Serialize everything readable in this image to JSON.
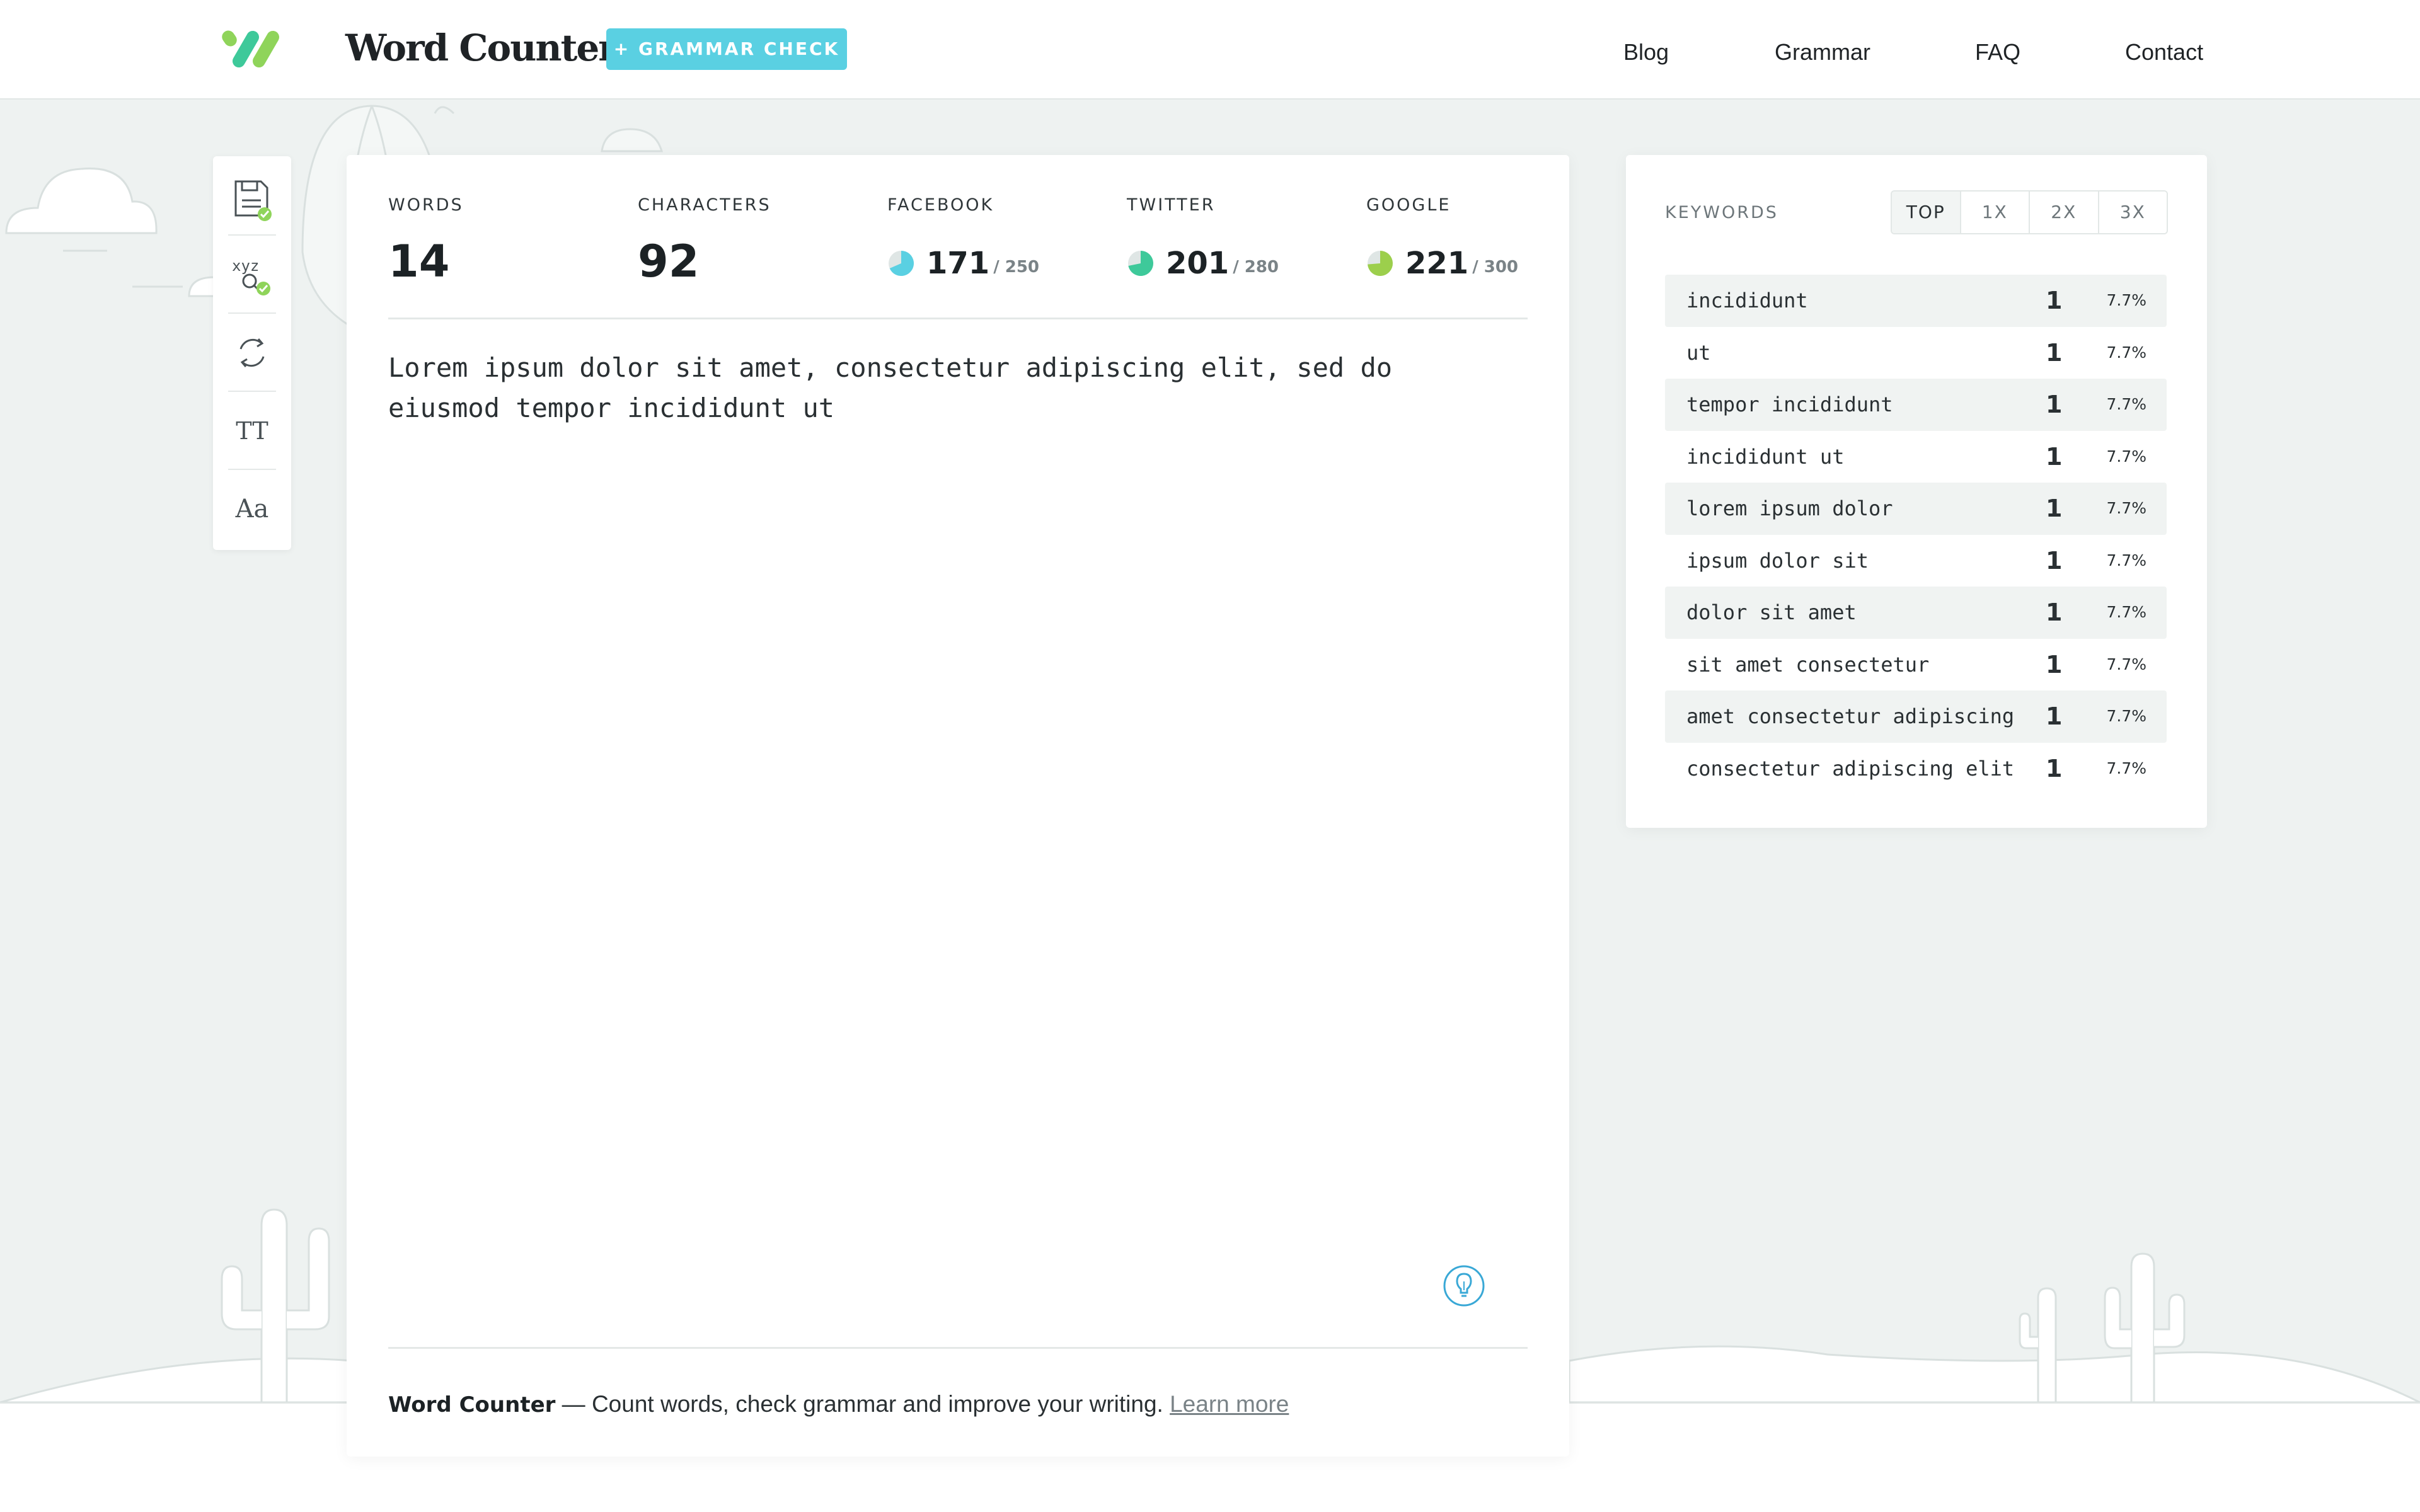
{
  "colors": {
    "accent": "#5ad0e2",
    "logo_green": "#8fd45a",
    "logo_teal": "#3ec99a",
    "facebook_dot": "#5ad0e2",
    "twitter_dot": "#3ec99a",
    "google_dot": "#9ccf4c",
    "background": "#eef2f1"
  },
  "header": {
    "brand": "Word Counter",
    "grammar_button": "+ GRAMMAR CHECK",
    "nav": [
      "Blog",
      "Grammar",
      "FAQ",
      "Contact"
    ]
  },
  "toolbar": {
    "tools": [
      "save-icon",
      "spellcheck-icon",
      "refresh-icon",
      "text-size-icon",
      "font-icon"
    ],
    "text_size_label": "TT",
    "font_label": "Aa"
  },
  "stats": {
    "words_label": "WORDS",
    "words": "14",
    "characters_label": "CHARACTERS",
    "characters": "92",
    "facebook_label": "FACEBOOK",
    "facebook_value": "171",
    "facebook_limit": "/ 250",
    "facebook_fraction": 0.684,
    "twitter_label": "TWITTER",
    "twitter_value": "201",
    "twitter_limit": "/ 280",
    "twitter_fraction": 0.718,
    "google_label": "GOOGLE",
    "google_value": "221",
    "google_limit": "/ 300",
    "google_fraction": 0.737
  },
  "editor": {
    "text": "Lorem ipsum dolor sit amet, consectetur adipiscing elit, sed do\neiusmod tempor incididunt ut",
    "tip_icon": "lightbulb-icon"
  },
  "footer": {
    "brand": "Word Counter",
    "tagline": " — Count words, check grammar and improve your writing. ",
    "learn_more": "Learn more"
  },
  "keywords": {
    "title": "KEYWORDS",
    "tabs": [
      "TOP",
      "1X",
      "2X",
      "3X"
    ],
    "active_tab": "TOP",
    "items": [
      {
        "phrase": "incididunt",
        "count": "1",
        "percent": "7.7%"
      },
      {
        "phrase": "ut",
        "count": "1",
        "percent": "7.7%"
      },
      {
        "phrase": "tempor incididunt",
        "count": "1",
        "percent": "7.7%"
      },
      {
        "phrase": "incididunt ut",
        "count": "1",
        "percent": "7.7%"
      },
      {
        "phrase": "lorem ipsum dolor",
        "count": "1",
        "percent": "7.7%"
      },
      {
        "phrase": "ipsum dolor sit",
        "count": "1",
        "percent": "7.7%"
      },
      {
        "phrase": "dolor sit amet",
        "count": "1",
        "percent": "7.7%"
      },
      {
        "phrase": "sit amet consectetur",
        "count": "1",
        "percent": "7.7%"
      },
      {
        "phrase": "amet consectetur adipiscing",
        "count": "1",
        "percent": "7.7%"
      },
      {
        "phrase": "consectetur adipiscing elit",
        "count": "1",
        "percent": "7.7%"
      }
    ]
  }
}
